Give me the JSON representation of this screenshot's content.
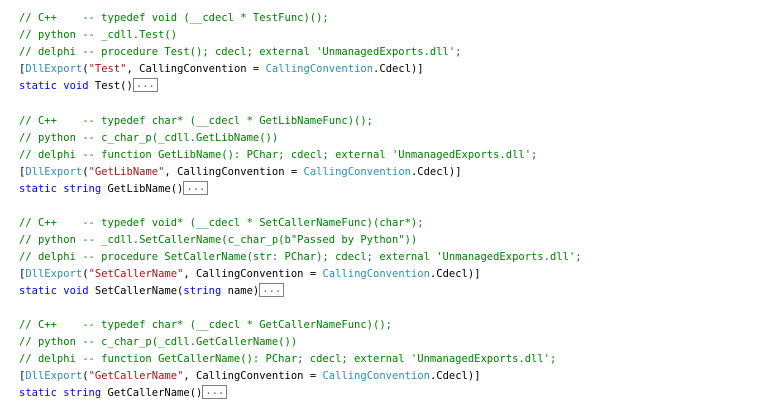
{
  "blocks": [
    {
      "cpp_comment": "// C++    -- typedef void (__cdecl * TestFunc)();",
      "python_comment": "// python -- _cdll.Test()",
      "delphi_comment": "// delphi -- procedure Test(); cdecl; external 'UnmanagedExports.dll';",
      "attr_open": "[",
      "attr_name": "DllExport",
      "attr_paren": "(",
      "attr_str": "\"Test\"",
      "attr_mid": ", CallingConvention = ",
      "attr_type1": "CallingConvention",
      "attr_dot": ".Cdecl)]",
      "sig_keywords": "static void",
      "sig_rest_pre": " Test(",
      "sig_param_kw": "",
      "sig_param_rest": "",
      "sig_close": ")",
      "fold": "..."
    },
    {
      "cpp_comment": "// C++    -- typedef char* (__cdecl * GetLibNameFunc)();",
      "python_comment": "// python -- c_char_p(_cdll.GetLibName())",
      "delphi_comment": "// delphi -- function GetLibName(): PChar; cdecl; external 'UnmanagedExports.dll';",
      "attr_open": "[",
      "attr_name": "DllExport",
      "attr_paren": "(",
      "attr_str": "\"GetLibName\"",
      "attr_mid": ", CallingConvention = ",
      "attr_type1": "CallingConvention",
      "attr_dot": ".Cdecl)]",
      "sig_keywords": "static string",
      "sig_rest_pre": " GetLibName(",
      "sig_param_kw": "",
      "sig_param_rest": "",
      "sig_close": ")",
      "fold": "..."
    },
    {
      "cpp_comment": "// C++    -- typedef void* (__cdecl * SetCallerNameFunc)(char*);",
      "python_comment": "// python -- _cdll.SetCallerName(c_char_p(b\"Passed by Python\"))",
      "delphi_comment": "// delphi -- procedure SetCallerName(str: PChar); cdecl; external 'UnmanagedExports.dll';",
      "attr_open": "[",
      "attr_name": "DllExport",
      "attr_paren": "(",
      "attr_str": "\"SetCallerName\"",
      "attr_mid": ", CallingConvention = ",
      "attr_type1": "CallingConvention",
      "attr_dot": ".Cdecl)]",
      "sig_keywords": "static void",
      "sig_rest_pre": " SetCallerName(",
      "sig_param_kw": "string",
      "sig_param_rest": " name",
      "sig_close": ")",
      "fold": "..."
    },
    {
      "cpp_comment": "// C++    -- typedef char* (__cdecl * GetCallerNameFunc)();",
      "python_comment": "// python -- c_char_p(_cdll.GetCallerName())",
      "delphi_comment": "// delphi -- function GetCallerName(): PChar; cdecl; external 'UnmanagedExports.dll';",
      "attr_open": "[",
      "attr_name": "DllExport",
      "attr_paren": "(",
      "attr_str": "\"GetCallerName\"",
      "attr_mid": ", CallingConvention = ",
      "attr_type1": "CallingConvention",
      "attr_dot": ".Cdecl)]",
      "sig_keywords": "static string",
      "sig_rest_pre": " GetCallerName(",
      "sig_param_kw": "",
      "sig_param_rest": "",
      "sig_close": ")",
      "fold": "..."
    }
  ],
  "colors": {
    "comment": "#008000",
    "keyword": "#0000ff",
    "string": "#a31515",
    "type": "#2b91af",
    "text": "#000000",
    "background": "#ffffff"
  }
}
